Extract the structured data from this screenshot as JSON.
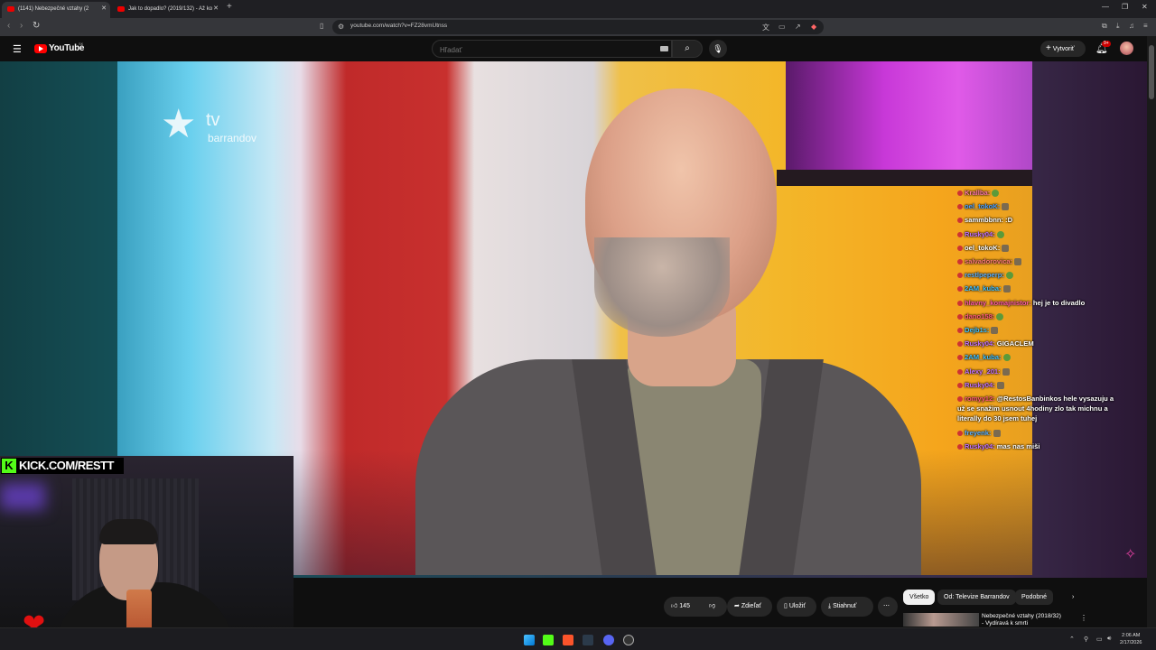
{
  "browser": {
    "tabs": [
      {
        "title": "(1141) Nebezpečné vztahy (2"
      },
      {
        "title": "Jak to dopadlo? (2019/132) - Až ko"
      }
    ],
    "url": "youtube.com/watch?v=FZ28vmUtnss"
  },
  "youtube": {
    "logo": "YouTube",
    "country": "SK",
    "search_placeholder": "Hľadať",
    "create_label": "Vytvoriť",
    "notif_count": "9+"
  },
  "video": {
    "channel_logo_top": "tv",
    "channel_logo_bottom": "barrandov"
  },
  "stream": {
    "kick_letter": "K",
    "kick_url": "KICK.COM/RESTT"
  },
  "chat": [
    {
      "user": "Krallba:",
      "color": "#ff7aa8",
      "text": ""
    },
    {
      "user": "oel_tokoK:",
      "color": "#4aa0ff",
      "text": ""
    },
    {
      "user": "sammbbnn:",
      "color": "#ffffff",
      "text": ":D"
    },
    {
      "user": "Rusky04:",
      "color": "#c070ff",
      "text": ""
    },
    {
      "user": "oel_tokoK:",
      "color": "#ffffff",
      "text": ""
    },
    {
      "user": "salvadorovica:",
      "color": "#ff7a7a",
      "text": ""
    },
    {
      "user": "restlpeperp:",
      "color": "#5ab0ff",
      "text": ""
    },
    {
      "user": "2AM_kuba:",
      "color": "#3fc0ff",
      "text": ""
    },
    {
      "user": "hlavny_komajnistor:",
      "color": "#ff5aa8",
      "text": "hej je to divadlo"
    },
    {
      "user": "dano158:",
      "color": "#ff5a7a",
      "text": ""
    },
    {
      "user": "Dejb1s:",
      "color": "#3fc0ff",
      "text": ""
    },
    {
      "user": "Rusky04:",
      "color": "#c070ff",
      "text": "GIGACLEM"
    },
    {
      "user": "2AM_kuba:",
      "color": "#3fc0ff",
      "text": ""
    },
    {
      "user": "Alexy_201:",
      "color": "#c070ff",
      "text": ""
    },
    {
      "user": "Rusky04:",
      "color": "#c070ff",
      "text": ""
    },
    {
      "user": "romyy12:",
      "color": "#ff5a7a",
      "text": "@RestosBanbinkos hele vysazuju a už se snažim usnout 4hodiny zlo tak michnu a literally do 30 jsem tuhej"
    },
    {
      "user": "freyenk:",
      "color": "#5ab0ff",
      "text": ""
    },
    {
      "user": "Rusky04:",
      "color": "#c070ff",
      "text": "mas nas miši"
    }
  ],
  "actions": {
    "likes": "145",
    "share": "Zdieľať",
    "save": "Uložiť",
    "download": "Stiahnuť"
  },
  "chips": [
    "Všetko",
    "Od: Televize Barrandov",
    "Podobné"
  ],
  "recommended": {
    "title": "Nebezpečné vztahy (2018/32) - Vydíravá k smrti"
  },
  "taskbar": {
    "time": "2:06 AM",
    "date": "2/17/2026"
  },
  "colors": {
    "youtube_red": "#ff0000",
    "kick_green": "#53fc18"
  }
}
